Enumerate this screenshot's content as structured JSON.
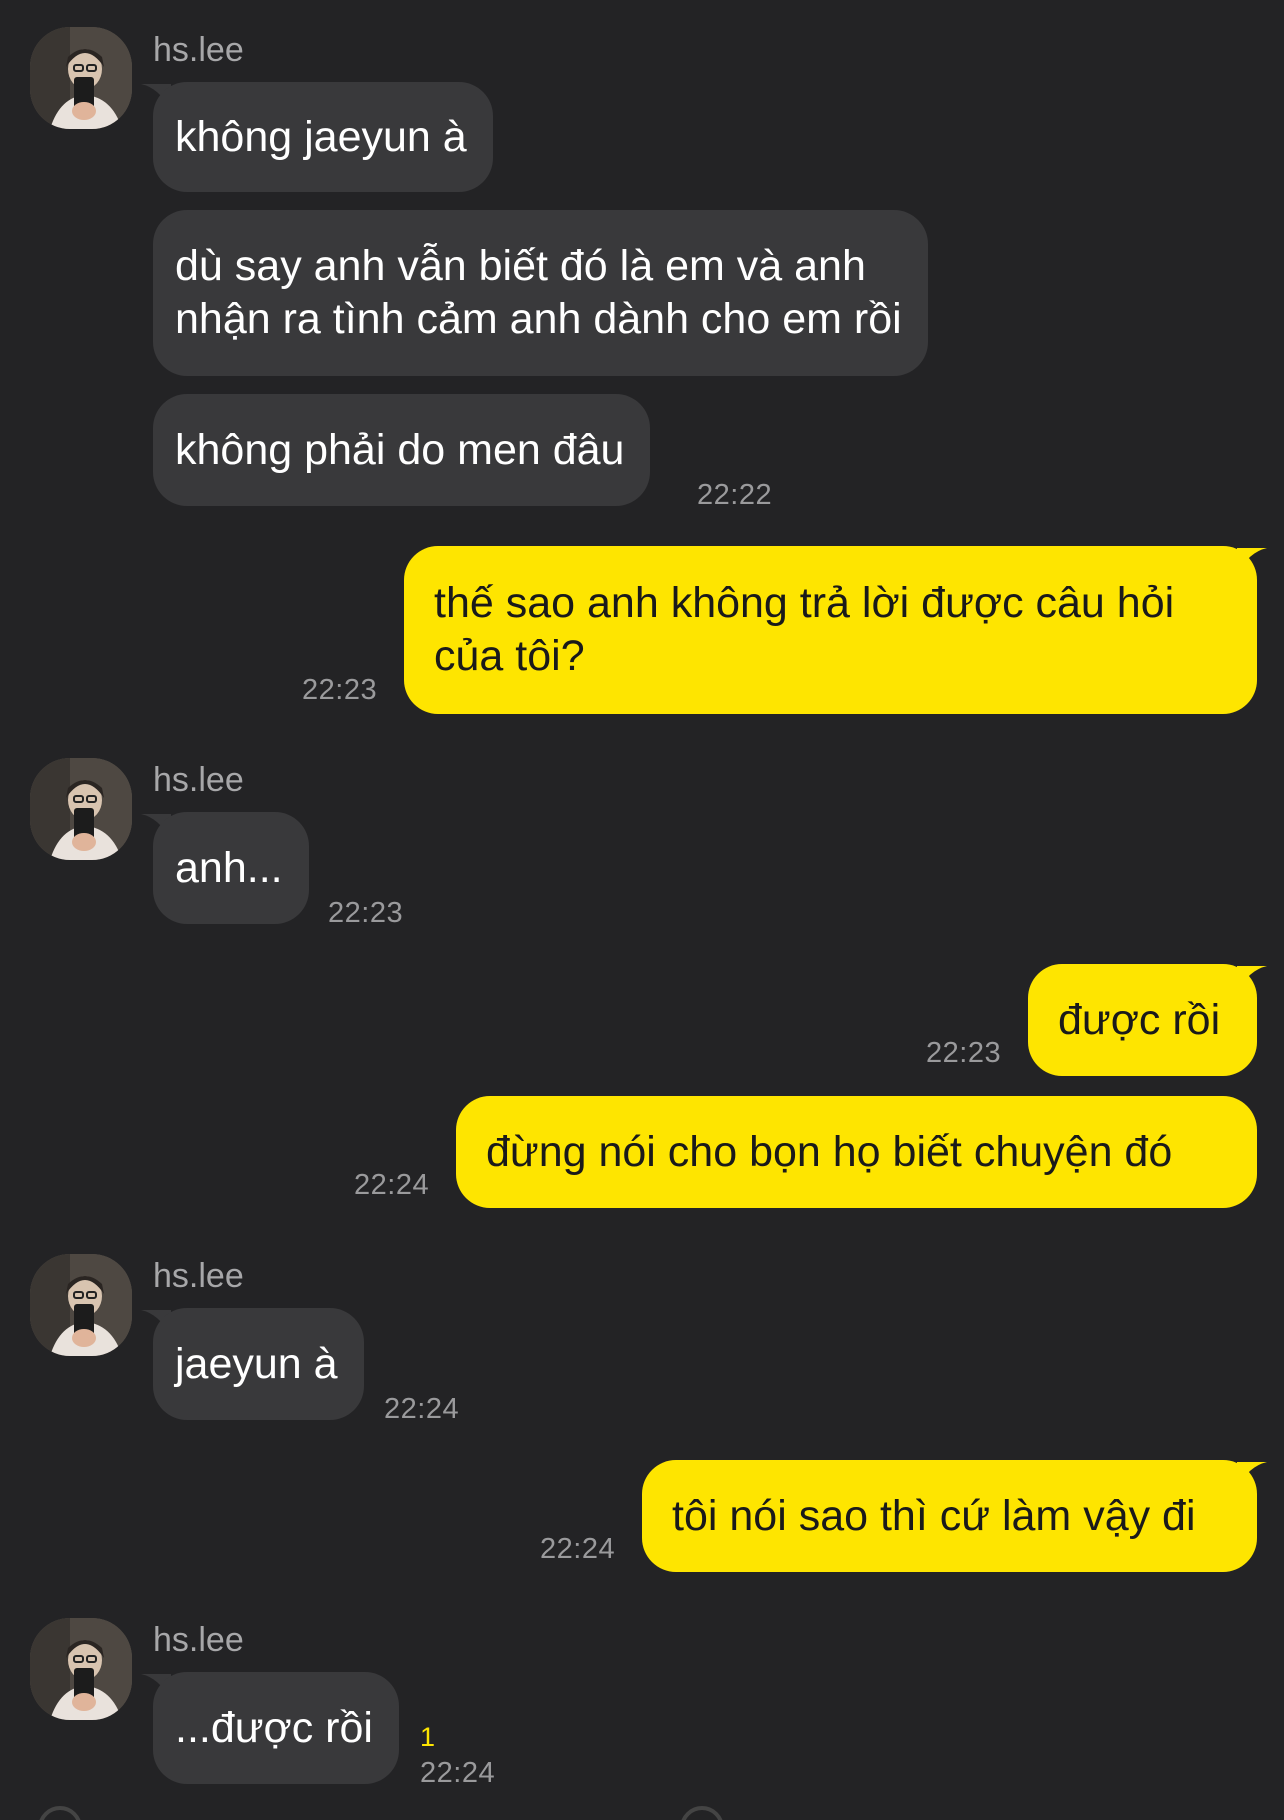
{
  "conversation": {
    "contact_name": "hs.lee",
    "groups": [
      {
        "sender": "hs.lee",
        "messages": [
          {
            "text": "không jaeyun à"
          },
          {
            "text": "dù say anh vẫn biết đó là em và anh\nnhận ra tình cảm anh dành cho em rồi"
          },
          {
            "text": "không phải do men đâu",
            "time": "22:22"
          }
        ]
      },
      {
        "sender": "me",
        "messages": [
          {
            "text": "thế sao anh không trả lời được câu hỏi\ncủa tôi?",
            "time": "22:23"
          }
        ]
      },
      {
        "sender": "hs.lee",
        "messages": [
          {
            "text": "anh...",
            "time": "22:23"
          }
        ]
      },
      {
        "sender": "me",
        "messages": [
          {
            "text": "được rồi",
            "time": "22:23"
          },
          {
            "text": "đừng nói cho bọn họ biết chuyện đó",
            "time": "22:24"
          }
        ]
      },
      {
        "sender": "hs.lee",
        "messages": [
          {
            "text": "jaeyun à",
            "time": "22:24"
          }
        ]
      },
      {
        "sender": "me",
        "messages": [
          {
            "text": "tôi nói sao thì cứ làm vậy đi",
            "time": "22:24"
          }
        ]
      },
      {
        "sender": "hs.lee",
        "messages": [
          {
            "text": "...được rồi",
            "time": "22:24",
            "unread": "1"
          }
        ]
      }
    ]
  },
  "theme": {
    "background": "#232325",
    "incoming_bubble": "#39393b",
    "outgoing_bubble": "#fee500",
    "unread_color": "#fee500"
  },
  "icons": {
    "avatar": "profile-photo-avatar",
    "tail": "bubble-tail"
  }
}
